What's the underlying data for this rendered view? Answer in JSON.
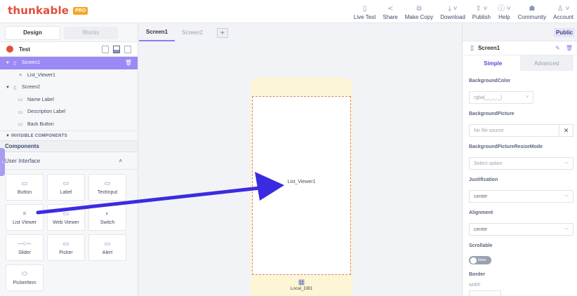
{
  "app": {
    "logo_text": "thunkable",
    "badge": "PRO"
  },
  "nav": [
    {
      "label": "Live Test",
      "icon": "▯",
      "icon_name": "phone-icon"
    },
    {
      "label": "Share",
      "icon": "≺",
      "icon_name": "share-icon"
    },
    {
      "label": "Make Copy",
      "icon": "⧉",
      "icon_name": "copy-icon"
    },
    {
      "label": "Download",
      "icon": "⤓ ˅",
      "icon_name": "download-icon"
    },
    {
      "label": "Publish",
      "icon": "⇪ ˅",
      "icon_name": "publish-icon"
    },
    {
      "label": "Help",
      "icon": "ⓘ ˅",
      "icon_name": "help-icon"
    },
    {
      "label": "Community",
      "icon": "☗",
      "icon_name": "community-icon"
    },
    {
      "label": "Account",
      "icon": "♙ ˅",
      "icon_name": "account-icon"
    }
  ],
  "left": {
    "tabs": {
      "design": "Design",
      "blocks": "Blocks"
    },
    "project_name": "Test",
    "tree": [
      {
        "label": "Screen1",
        "icon": "▯",
        "selected": true
      },
      {
        "label": "List_Viewer1",
        "icon": "≡"
      },
      {
        "label": "Screen2",
        "icon": "▯"
      },
      {
        "label": "Name Label",
        "icon": "▭"
      },
      {
        "label": "Description Label",
        "icon": "▭"
      },
      {
        "label": "Back Button",
        "icon": "▭"
      }
    ],
    "invisible_header": "INVISIBLE COMPONENTS",
    "components_header": "Components",
    "ui_header": "User Interface",
    "components": [
      {
        "label": "Button",
        "icon": "▭"
      },
      {
        "label": "Label",
        "icon": "▭"
      },
      {
        "label": "TextInput",
        "icon": "▭"
      },
      {
        "label": "List Viewer",
        "icon": "≡"
      },
      {
        "label": "Web Viewer",
        "icon": "▭"
      },
      {
        "label": "Switch",
        "icon": "◐"
      },
      {
        "label": "Slider",
        "icon": "─○─"
      },
      {
        "label": "Picker",
        "icon": "▭"
      },
      {
        "label": "Alert",
        "icon": "▭"
      },
      {
        "label": "PickerItem",
        "icon": "⬭"
      }
    ]
  },
  "center": {
    "tabs": [
      "Screen1",
      "Screen2"
    ],
    "add_label": "+",
    "canvas_component": "List_Viewer1",
    "invisible_component": "Local_DB1",
    "arrow_color": "#3b2be0"
  },
  "right": {
    "public_label": "Public",
    "screen_title": "Screen1",
    "subtabs": {
      "simple": "Simple",
      "advanced": "Advanced"
    },
    "props": {
      "bg_color_label": "BackgroundColor",
      "bg_color_value": "rgba(_,_,_,_)",
      "bg_picture_label": "BackgroundPicture",
      "bg_picture_value": "No file source",
      "resize_label": "BackgroundPictureResizeMode",
      "resize_placeholder": "Select option",
      "justification_label": "Justification",
      "justification_value": "center",
      "alignment_label": "Alignment",
      "alignment_value": "center",
      "scrollable_label": "Scrollable",
      "scrollable_value": "false",
      "border_label": "Border",
      "border_width_label": "width"
    }
  }
}
